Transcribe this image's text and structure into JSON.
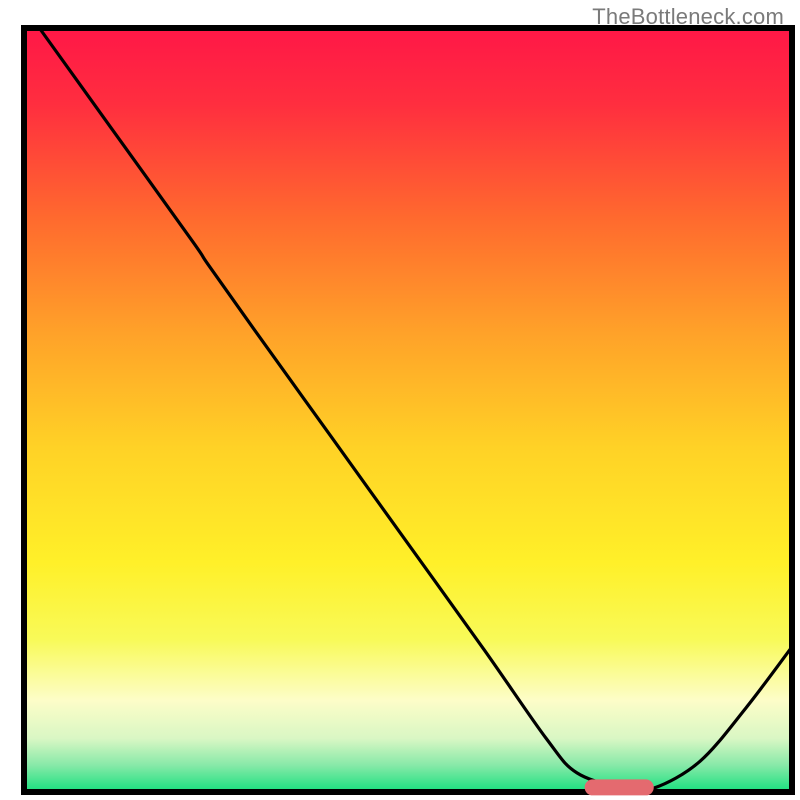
{
  "watermark": "TheBottleneck.com",
  "chart_data": {
    "type": "line",
    "title": "",
    "xlabel": "",
    "ylabel": "",
    "xlim": [
      0,
      100
    ],
    "ylim": [
      0,
      100
    ],
    "series": [
      {
        "name": "curve",
        "x": [
          2,
          12,
          22,
          24,
          30,
          40,
          50,
          60,
          68,
          72,
          78,
          82,
          88,
          94,
          100
        ],
        "y": [
          100,
          86,
          72,
          69,
          60.5,
          46.5,
          32.5,
          18.5,
          7,
          2.5,
          0.5,
          0.5,
          4,
          11,
          19
        ]
      }
    ],
    "marker": {
      "x0": 73,
      "x1": 82,
      "y": 0.6
    },
    "gradient_stops": [
      {
        "offset": 0.0,
        "color": "#ff1747"
      },
      {
        "offset": 0.1,
        "color": "#ff2e3f"
      },
      {
        "offset": 0.25,
        "color": "#ff6a2e"
      },
      {
        "offset": 0.4,
        "color": "#ffa229"
      },
      {
        "offset": 0.55,
        "color": "#ffd226"
      },
      {
        "offset": 0.7,
        "color": "#fff029"
      },
      {
        "offset": 0.8,
        "color": "#f8fa58"
      },
      {
        "offset": 0.88,
        "color": "#fdfdc8"
      },
      {
        "offset": 0.93,
        "color": "#d9f7c4"
      },
      {
        "offset": 0.965,
        "color": "#87e9a8"
      },
      {
        "offset": 1.0,
        "color": "#17e07e"
      }
    ],
    "border_color": "#000000",
    "marker_color": "#e46a6f"
  }
}
